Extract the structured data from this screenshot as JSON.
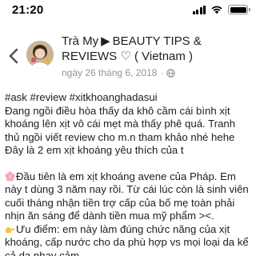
{
  "status_bar": {
    "time": "21:20"
  },
  "post": {
    "author": "Trà My",
    "group": "BEAUTY TIPS & REVIEWS ♡ ( Vietnam )",
    "date": "ngày 26 tháng 6, 2018",
    "dot": "·",
    "hashtags": "#ask #review #xitkhoanghadasui",
    "paragraph1": "Đang ngồi điều hòa thấy da khô cầm cái bình xịt khoáng lên xịt vô cái mẹt mà thấy phê quá. Tranh thủ ngồi viết review cho m.n tham khảo nhé hehe",
    "paragraph2": "Đây là 2 em xịt khoáng yêu thích của t",
    "paragraph3": "Đầu tiên là em xịt khoáng avene của Pháp. Em này t dùng 3 năm nay rồi. Từ cái lúc còn là sinh viên cuối tháng nhận tiền trợ cấp của bố mẹ toàn phải nhịn ăn sáng để dành tiền mua mỹ phẩm ><.",
    "paragraph4": "Ưu điểm: em này làm đúng chức năng của xịt khoáng, cấp nước cho da phù hợp vs mọi loại da kể cả da nhạy cảm."
  },
  "icons": {
    "back": "chevron-left-icon",
    "avatar": "profile-photo",
    "group_arrow": "right-triangle-icon",
    "privacy": "globe-icon",
    "para3_emoji": "cherry-blossom-icon",
    "para4_emoji": "pointing-hand-icon"
  }
}
